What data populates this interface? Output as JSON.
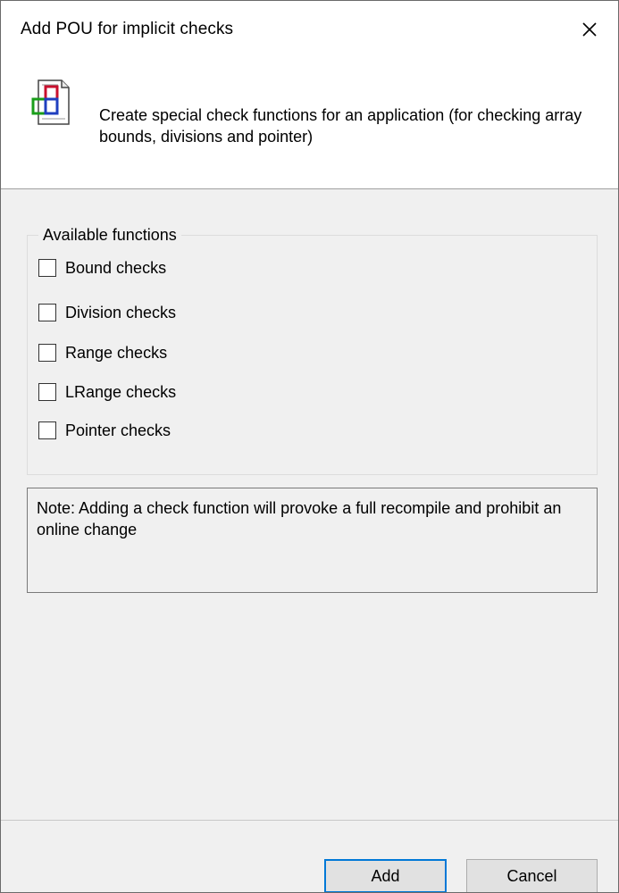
{
  "window": {
    "title": "Add POU for implicit checks",
    "close_icon": "close-icon"
  },
  "header": {
    "icon": "pou-document-icon",
    "description": "Create special check functions for an application (for checking array bounds, divisions and pointer)"
  },
  "group": {
    "legend": "Available functions",
    "options": [
      {
        "label": "Bound checks",
        "checked": false
      },
      {
        "label": "Division checks",
        "checked": false
      },
      {
        "label": "Range checks",
        "checked": false
      },
      {
        "label": "LRange checks",
        "checked": false
      },
      {
        "label": "Pointer checks",
        "checked": false
      }
    ]
  },
  "note": {
    "text": "Note: Adding a check function will provoke a full recompile and prohibit an online change"
  },
  "buttons": {
    "add": "Add",
    "cancel": "Cancel"
  },
  "colors": {
    "dialog_bg": "#f0f0f0",
    "header_bg": "#ffffff",
    "default_button_border": "#0078d7"
  }
}
